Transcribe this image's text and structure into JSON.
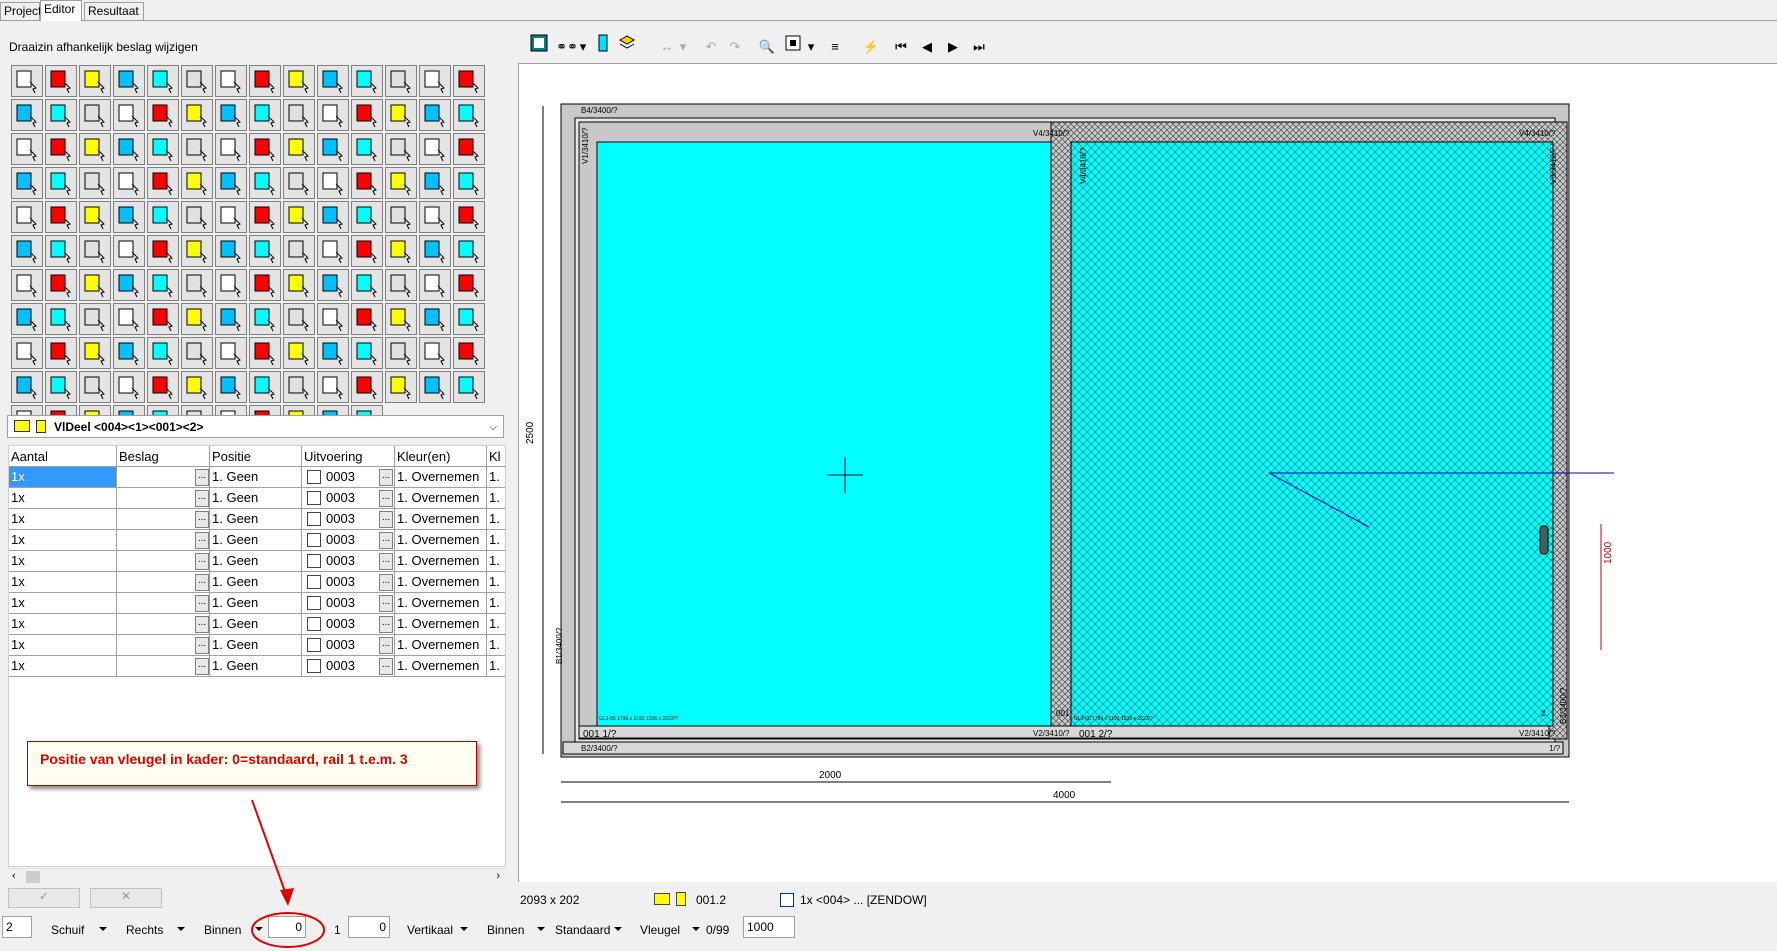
{
  "tabs": [
    "Project",
    "Editor",
    "Resultaat"
  ],
  "active_tab": 1,
  "section_title": "Draaizin afhankelijk beslag wijzigen",
  "element_combo": "VlDeel <004><1><001><2>",
  "grid": {
    "columns": [
      "Aantal",
      "Beslag",
      "Positie",
      "Uitvoering",
      "Kleur(en)",
      "Kl"
    ],
    "rows": [
      {
        "aantal": "1x",
        "beslag": "",
        "positie": "1. Geen",
        "uitvoering": "0003",
        "kleur": "1. Overnemen",
        "kl": "1."
      },
      {
        "aantal": "1x",
        "beslag": "",
        "positie": "1. Geen",
        "uitvoering": "0003",
        "kleur": "1. Overnemen",
        "kl": "1."
      },
      {
        "aantal": "1x",
        "beslag": "",
        "positie": "1. Geen",
        "uitvoering": "0003",
        "kleur": "1. Overnemen",
        "kl": "1."
      },
      {
        "aantal": "1x",
        "beslag": "",
        "positie": "1. Geen",
        "uitvoering": "0003",
        "kleur": "1. Overnemen",
        "kl": "1."
      },
      {
        "aantal": "1x",
        "beslag": "",
        "positie": "1. Geen",
        "uitvoering": "0003",
        "kleur": "1. Overnemen",
        "kl": "1."
      },
      {
        "aantal": "1x",
        "beslag": "",
        "positie": "1. Geen",
        "uitvoering": "0003",
        "kleur": "1. Overnemen",
        "kl": "1."
      },
      {
        "aantal": "1x",
        "beslag": "",
        "positie": "1. Geen",
        "uitvoering": "0003",
        "kleur": "1. Overnemen",
        "kl": "1."
      },
      {
        "aantal": "1x",
        "beslag": "",
        "positie": "1. Geen",
        "uitvoering": "0003",
        "kleur": "1. Overnemen",
        "kl": "1."
      },
      {
        "aantal": "1x",
        "beslag": "",
        "positie": "1. Geen",
        "uitvoering": "0003",
        "kleur": "1. Overnemen",
        "kl": "1."
      },
      {
        "aantal": "1x",
        "beslag": "",
        "positie": "1. Geen",
        "uitvoering": "0003",
        "kleur": "1. Overnemen",
        "kl": "1."
      }
    ],
    "dots_label": "..."
  },
  "callout_text": "Positie van vleugel in kader: 0=standaard, rail 1 t.e.m. 3",
  "drawing": {
    "frame_labels": {
      "top_outer": "B4/3400/?",
      "top_inner": "V4/3410/?",
      "top_inner_right": "V4/3410/?",
      "left_outer": "B1/3400/?",
      "left_inner": "V1/3410/?",
      "mid_left": "V4/3410/?",
      "right_inner": "V3/3410/?",
      "right_outer": "B3/3400/?",
      "bottom_inner": "V2/3410/?",
      "bottom_inner_right": "V2/3410/?",
      "bottom_outer": "B2/3400/?",
      "sash_left_id": "001",
      "sash_left_pos": "001 1/?",
      "sash_right_pos": "001 2/?",
      "right_corner": "1/?",
      "left_glass_note": "GL3-05 1799 x 2192 1526 x 2222/?",
      "right_glass_note": "GL3-05 1799 x 2192 1526 x 2222/?",
      "right_sash_id": "2"
    },
    "dim_height": "2500",
    "dim_half_width": "2000",
    "dim_width": "4000",
    "dim_handle": "1000"
  },
  "status": {
    "size": "2093 x 202",
    "element": "001.2",
    "description": "1x <004> ... [ZENDOW]"
  },
  "bottom": {
    "field1": "2",
    "type": "Schuif",
    "side": "Rechts",
    "in1": "Binnen",
    "position": "0",
    "num1": "1",
    "num2": "0",
    "orientation": "Vertikaal",
    "in2": "Binnen",
    "standard": "Standaard",
    "wing": "Vleugel",
    "counter": "0/99",
    "value": "1000"
  },
  "colors": {
    "glass": "#00ffff",
    "frame": "#c8c8c8",
    "callout_text": "#e00000",
    "selection": "#3399ff"
  }
}
